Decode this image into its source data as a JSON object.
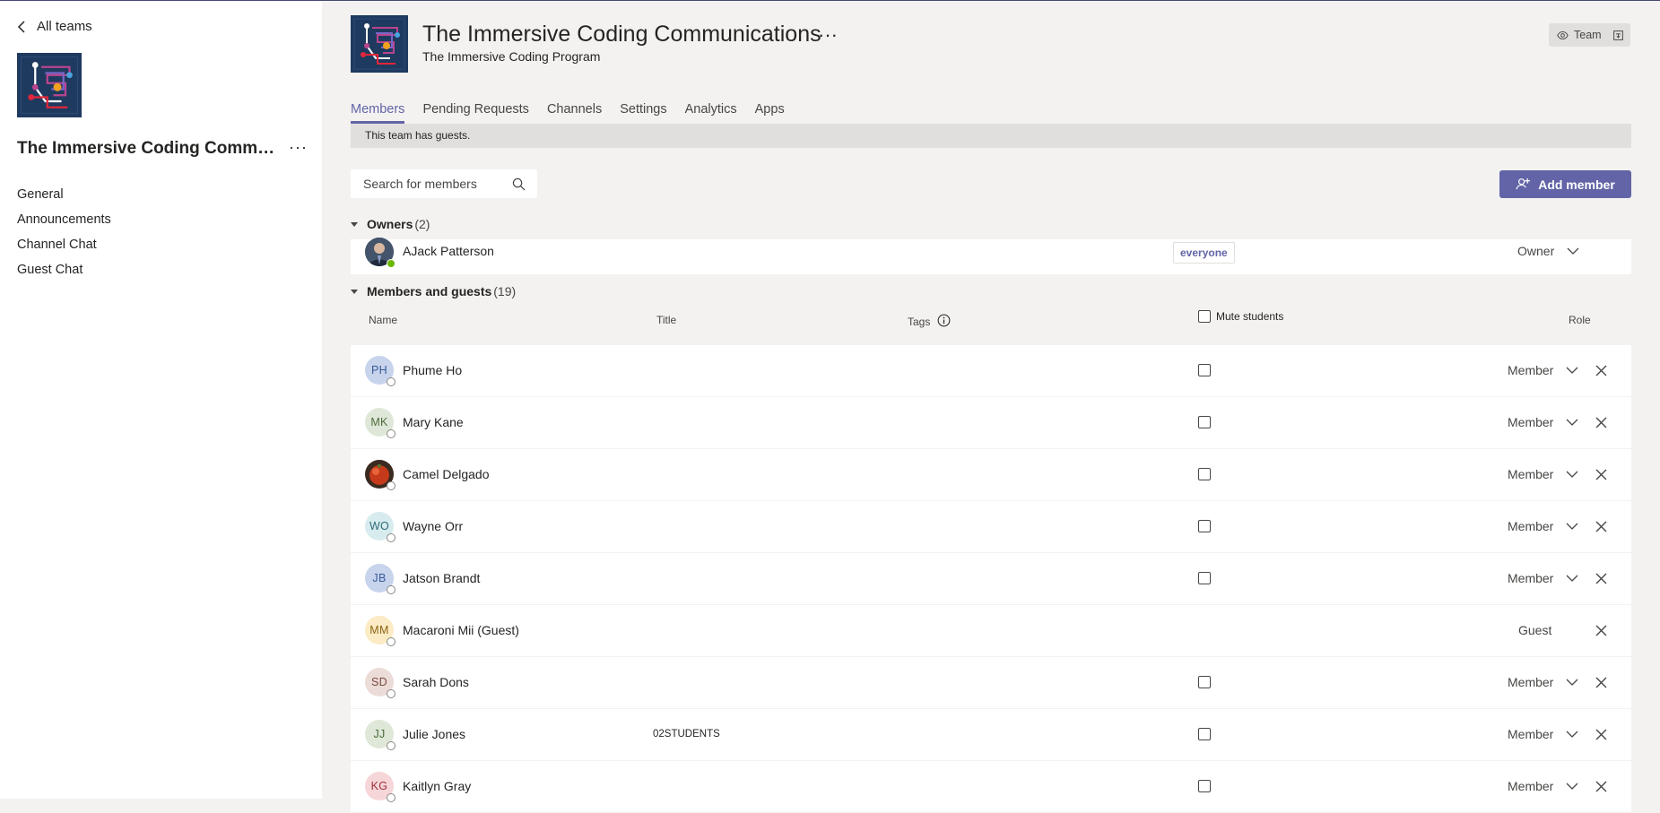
{
  "nav": {
    "back_label": "All teams"
  },
  "team": {
    "name": "The Immersive Coding Communications",
    "short_name": "The Immersive Coding Communi...",
    "subtitle": "The Immersive Coding Program",
    "more": "···",
    "visibility_label": "Team"
  },
  "channels": [
    "General",
    "Announcements",
    "Channel Chat",
    "Guest Chat"
  ],
  "tabs": [
    "Members",
    "Pending Requests",
    "Channels",
    "Settings",
    "Analytics",
    "Apps"
  ],
  "active_tab": "Members",
  "banner": "This team has guests.",
  "search": {
    "placeholder": "Search for members"
  },
  "add_member_label": "Add member",
  "owners": {
    "label": "Owners",
    "count": "(2)",
    "rows": [
      {
        "name": "AJack Patterson",
        "tag": "everyone",
        "role": "Owner"
      }
    ]
  },
  "members": {
    "label": "Members and guests",
    "count": "(19)",
    "columns": {
      "name": "Name",
      "title": "Title",
      "tags": "Tags",
      "mute": "Mute students",
      "role": "Role"
    },
    "rows": [
      {
        "initials": "PH",
        "name": "Phume Ho",
        "title": "",
        "role": "Member",
        "bg": "#c7d4ec",
        "fg": "#3b5a9a"
      },
      {
        "initials": "MK",
        "name": "Mary Kane",
        "title": "",
        "role": "Member",
        "bg": "#dfe8d8",
        "fg": "#4b6b3a"
      },
      {
        "initials": "",
        "name": "Camel Delgado",
        "title": "",
        "role": "Member",
        "bg": "#c43a1a",
        "fg": "#ffffff"
      },
      {
        "initials": "WO",
        "name": "Wayne Orr",
        "title": "",
        "role": "Member",
        "bg": "#d8ecef",
        "fg": "#2c6b78"
      },
      {
        "initials": "JB",
        "name": "Jatson Brandt",
        "title": "",
        "role": "Member",
        "bg": "#c7d4ec",
        "fg": "#3b5a9a"
      },
      {
        "initials": "MM",
        "name": "Macaroni Mii (Guest)",
        "title": "",
        "role": "Guest",
        "bg": "#fcebc4",
        "fg": "#8a6414"
      },
      {
        "initials": "SD",
        "name": "Sarah Dons",
        "title": "",
        "role": "Member",
        "bg": "#ecdcd8",
        "fg": "#7a4a3e"
      },
      {
        "initials": "JJ",
        "name": "Julie Jones",
        "title": "02STUDENTS",
        "role": "Member",
        "bg": "#dfe8d8",
        "fg": "#4b6b3a"
      },
      {
        "initials": "KG",
        "name": "Kaitlyn Gray",
        "title": "",
        "role": "Member",
        "bg": "#f6d6d8",
        "fg": "#a0323c"
      }
    ]
  },
  "colors": {
    "accent": "#6264a7",
    "rail_bg": "#ffffff",
    "page_bg": "#f3f2f1",
    "banner_bg": "#e1dfdd"
  }
}
